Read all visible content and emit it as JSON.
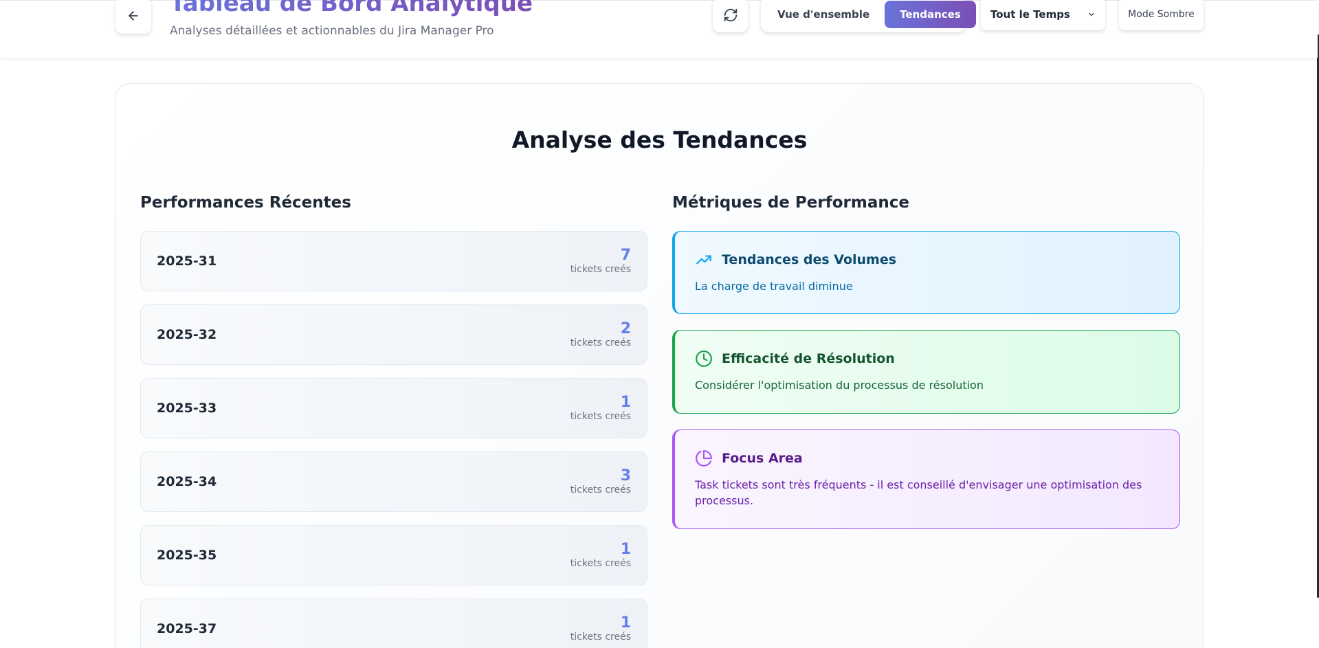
{
  "header": {
    "title": "Tableau de Bord Analytique",
    "subtitle": "Analyses détaillées et actionnables du Jira Manager Pro",
    "tabs": [
      {
        "label": "Vue d'ensemble",
        "active": false
      },
      {
        "label": "Tendances",
        "active": true
      }
    ],
    "period_select": {
      "value": "Tout le Temps"
    },
    "dark_mode_label": "Mode Sombre",
    "icons": {
      "back": "arrow-left-icon",
      "refresh": "refresh-icon",
      "dropdown": "chevron-down-icon"
    }
  },
  "main": {
    "title": "Analyse des Tendances",
    "recent": {
      "title": "Performances Récentes",
      "unit_label": "tickets creés",
      "weeks": [
        {
          "label": "2025-31",
          "count": "7"
        },
        {
          "label": "2025-32",
          "count": "2"
        },
        {
          "label": "2025-33",
          "count": "1"
        },
        {
          "label": "2025-34",
          "count": "3"
        },
        {
          "label": "2025-35",
          "count": "1"
        },
        {
          "label": "2025-37",
          "count": "1"
        }
      ]
    },
    "metrics": {
      "title": "Métriques de Performance",
      "items": [
        {
          "title": "Tendances des Volumes",
          "desc": "La charge de travail diminue",
          "icon": "trending-up-icon",
          "color": "#0ea5e9"
        },
        {
          "title": "Efficacité de Résolution",
          "desc": "Considérer l'optimisation du processus de résolution",
          "icon": "clock-icon",
          "color": "#16a34a"
        },
        {
          "title": "Focus Area",
          "desc": "Task tickets sont très fréquents - il est conseillé d'envisager une optimisation des processus.",
          "icon": "pie-chart-icon",
          "color": "#a855f7"
        }
      ]
    }
  },
  "colors": {
    "accent_start": "#667eea",
    "accent_end": "#764ba2"
  }
}
